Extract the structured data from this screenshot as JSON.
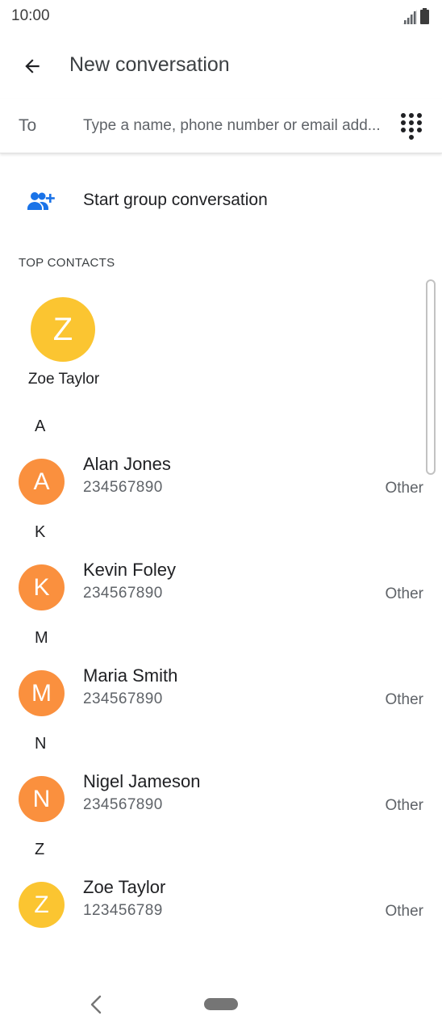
{
  "status_bar": {
    "time": "10:00",
    "icons": [
      "signal-icon",
      "battery-icon"
    ]
  },
  "app_bar": {
    "back_icon": "arrow-back-icon",
    "title": "New conversation"
  },
  "to_field": {
    "label": "To",
    "value": "",
    "placeholder": "Type a name, phone number or email add...",
    "dialpad_icon": "dialpad-icon"
  },
  "group": {
    "icon": "group-add-icon",
    "label": "Start group conversation",
    "icon_color": "#1a73e8"
  },
  "top_contacts": {
    "header": "TOP CONTACTS",
    "items": [
      {
        "initial": "Z",
        "name": "Zoe Taylor",
        "color": "#fbc531"
      }
    ]
  },
  "contacts": [
    {
      "letter": "A",
      "initial": "A",
      "name": "Alan Jones",
      "number": "234567890",
      "type": "Other",
      "color": "#fa903e"
    },
    {
      "letter": "K",
      "initial": "K",
      "name": "Kevin Foley",
      "number": "234567890",
      "type": "Other",
      "color": "#fa903e"
    },
    {
      "letter": "M",
      "initial": "M",
      "name": "Maria Smith",
      "number": "234567890",
      "type": "Other",
      "color": "#fa903e"
    },
    {
      "letter": "N",
      "initial": "N",
      "name": "Nigel Jameson",
      "number": "234567890",
      "type": "Other",
      "color": "#fa903e"
    },
    {
      "letter": "Z",
      "initial": "Z",
      "name": "Zoe Taylor",
      "number": "123456789",
      "type": "Other",
      "color": "#fbc531"
    }
  ],
  "nav_bar": {
    "icons": [
      "nav-back-icon",
      "nav-home-pill"
    ]
  }
}
